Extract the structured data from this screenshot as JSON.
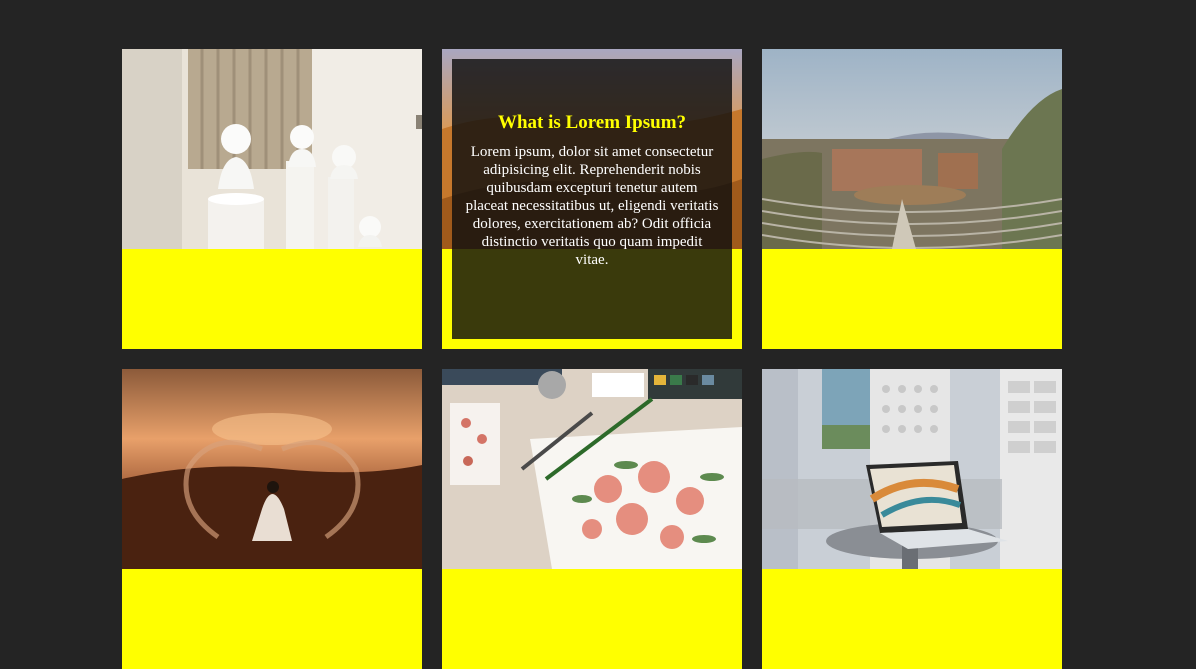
{
  "page": {
    "background": "#242424"
  },
  "theme": {
    "band_color": "#ffff00",
    "title_color": "#ffff00",
    "text_color": "#ffffff"
  },
  "gallery": {
    "cards": [
      {
        "image": "statue-busts-photo",
        "hovered": false
      },
      {
        "image": "desert-camel-caravan-photo",
        "hovered": true,
        "overlay_title": "What is Lorem Ipsum?",
        "overlay_text": "Lorem ipsum, dolor sit amet consectetur adipisicing elit. Reprehenderit nobis quibusdam excepturi tenetur autem placeat necessitatibus ut, eligendi veritatis dolores, exercitationem ab? Odit officia distinctio veritatis quo quam impedit vitae."
      },
      {
        "image": "ancient-theatre-photo",
        "hovered": false
      },
      {
        "image": "desert-sand-throw-photo",
        "hovered": false
      },
      {
        "image": "watercolor-flowers-photo",
        "hovered": false
      },
      {
        "image": "laptop-balcony-photo",
        "hovered": false
      }
    ]
  }
}
